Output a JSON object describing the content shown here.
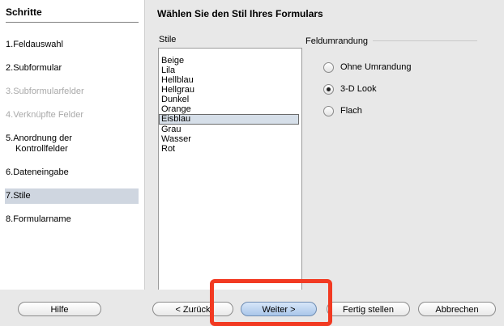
{
  "sidebar": {
    "title": "Schritte",
    "steps": [
      {
        "num": "1.",
        "label": "Feldauswahl",
        "state": "normal"
      },
      {
        "num": "2.",
        "label": "Subformular",
        "state": "normal"
      },
      {
        "num": "3.",
        "label": "Subformularfelder",
        "state": "disabled"
      },
      {
        "num": "4.",
        "label": "Verknüpfte Felder",
        "state": "disabled"
      },
      {
        "num": "5.",
        "label": "Anordnung der",
        "label2": "Kontrollfelder",
        "state": "normal"
      },
      {
        "num": "6.",
        "label": "Dateneingabe",
        "state": "normal"
      },
      {
        "num": "7.",
        "label": "Stile",
        "state": "active"
      },
      {
        "num": "8.",
        "label": "Formularname",
        "state": "normal"
      }
    ]
  },
  "main": {
    "title": "Wählen Sie den Stil Ihres Formulars",
    "styles_label": "Stile",
    "styles": [
      "Beige",
      "Lila",
      "Hellblau",
      "Hellgrau",
      "Dunkel",
      "Orange",
      "Eisblau",
      "Grau",
      "Wasser",
      "Rot"
    ],
    "selected_style": "Eisblau",
    "border_group": {
      "legend": "Feldumrandung",
      "options": [
        "Ohne Umrandung",
        "3-D Look",
        "Flach"
      ],
      "selected": "3-D Look"
    }
  },
  "buttons": {
    "help": "Hilfe",
    "back": "< Zurück",
    "next": "Weiter >",
    "finish": "Fertig stellen",
    "cancel": "Abbrechen"
  },
  "colors": {
    "highlight": "#f23a22",
    "active_step": "#cfd6e0",
    "selected_item": "#d6dfe9"
  }
}
